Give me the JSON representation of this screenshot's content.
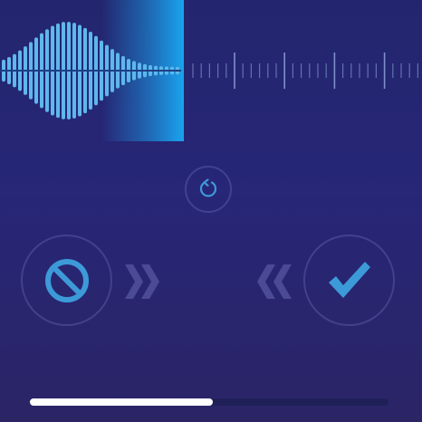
{
  "colors": {
    "background_top": "#23266e",
    "background_bottom": "#2b2566",
    "waveform_bar": "#5fb7ec",
    "playhead": "#1aa3ee",
    "tick": "#8ea3d8",
    "icon": "#3d9ad8",
    "chevron": "#4a4a95",
    "progress_fill": "#ffffff",
    "progress_track": "#1f2058"
  },
  "icons": {
    "refresh": "refresh-icon",
    "reject": "no-entry-icon",
    "accept": "checkmark-icon",
    "swipe_right": "double-chevron-right-icon",
    "swipe_left": "double-chevron-left-icon"
  },
  "progress": {
    "value": 0.51
  }
}
